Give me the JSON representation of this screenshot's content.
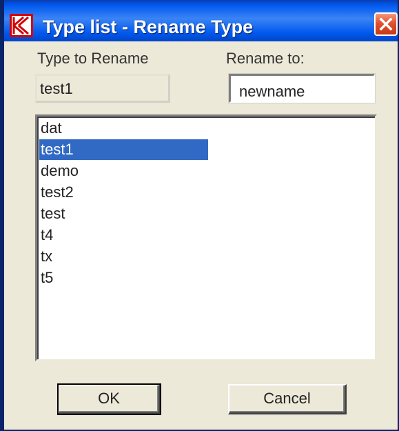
{
  "window": {
    "title": "Type list - Rename Type",
    "app_icon": "k-logo-icon",
    "close_icon": "close-icon"
  },
  "form": {
    "type_to_rename_label": "Type to Rename",
    "type_to_rename_value": "test1",
    "rename_to_label": "Rename to:",
    "rename_to_value": "newname"
  },
  "list": {
    "items": [
      "dat",
      "test1",
      "demo",
      "test2",
      "test",
      "t4",
      "tx",
      "t5"
    ],
    "selected_index": 1
  },
  "buttons": {
    "ok_label": "OK",
    "cancel_label": "Cancel"
  },
  "colors": {
    "title_bar": "#0058ee",
    "selection": "#316ac5",
    "dialog_bg": "#ece9d8",
    "close_button": "#e2512e"
  }
}
